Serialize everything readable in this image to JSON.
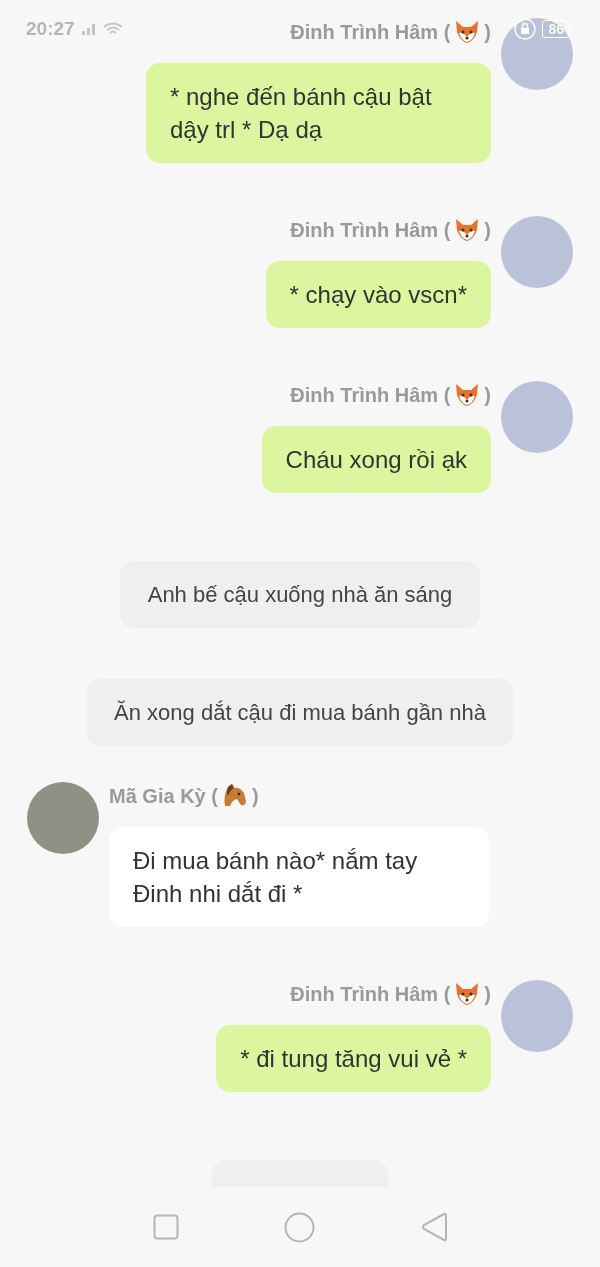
{
  "status_bar": {
    "time": "20:27",
    "battery": "86"
  },
  "messages": [
    {
      "kind": "right",
      "sender": {
        "name": "Đinh Trình Hâm (",
        "kind": "fox",
        "name_end": ")"
      },
      "text": "* nghe đến bánh cậu bật dậy trl * Dạ dạ"
    },
    {
      "kind": "right",
      "sender": {
        "name": "Đinh Trình Hâm (",
        "kind": "fox",
        "name_end": ")"
      },
      "text": "* chạy vào vscn*"
    },
    {
      "kind": "right",
      "sender": {
        "name": "Đinh Trình Hâm (",
        "kind": "fox",
        "name_end": ")"
      },
      "text": "Cháu xong rồi ạk"
    },
    {
      "kind": "narration",
      "text": "Anh bế cậu xuống nhà ăn sáng"
    },
    {
      "kind": "narration",
      "text": "Ăn xong dắt cậu đi mua bánh gần nhà"
    },
    {
      "kind": "left",
      "sender": {
        "name": "Mã Gia Kỳ (",
        "kind": "horse",
        "name_end": ")"
      },
      "text": "Đi mua bánh nào* nắm tay Đinh nhi dắt đi *"
    },
    {
      "kind": "right",
      "sender": {
        "name": "Đinh Trình Hâm (",
        "kind": "fox",
        "name_end": ")"
      },
      "text": "* đi tung tăng vui vẻ *"
    },
    {
      "kind": "clipped"
    }
  ]
}
